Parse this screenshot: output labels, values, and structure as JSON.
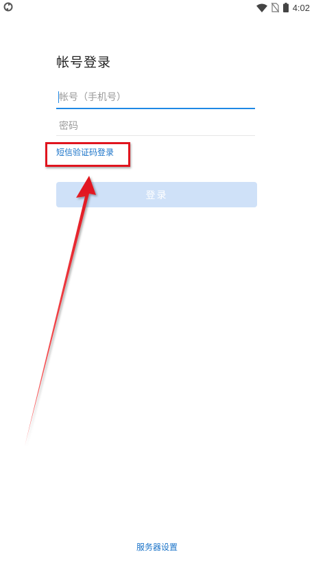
{
  "status_bar": {
    "time": "4:02",
    "left_icon": "sync-icon",
    "icons": [
      "wifi-icon",
      "no-sim-icon",
      "battery-icon"
    ]
  },
  "login": {
    "title": "帐号登录",
    "account_placeholder": "帐号（手机号）",
    "account_value": "",
    "password_placeholder": "密码",
    "password_value": "",
    "sms_login_link": "短信验证码登录",
    "login_button": "登录"
  },
  "footer": {
    "server_settings": "服务器设置"
  },
  "colors": {
    "accent": "#1e88e5",
    "link": "#1a73c8",
    "button_disabled": "#cfe1f8",
    "annotation_red": "#e0141e"
  }
}
